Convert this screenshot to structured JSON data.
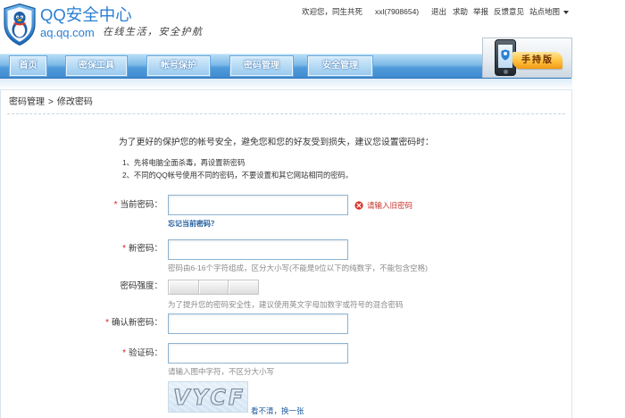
{
  "header": {
    "logo_title": "QQ安全中心",
    "logo_domain": "aq.qq.com",
    "slogan": "在线生活，安全护航",
    "welcome": "欢迎您，同生共死",
    "user": "xxl(7908654)",
    "logout": "退出",
    "help": "求助",
    "report": "举报",
    "feedback": "反馈意见",
    "sitemap": "站点地图",
    "mobile_promo": "手持版"
  },
  "nav": {
    "tabs": [
      "首页",
      "密保工具",
      "帐号保护",
      "密码管理",
      "安全管理"
    ]
  },
  "breadcrumb": {
    "parent": "密码管理",
    "separator": ">",
    "current": "修改密码"
  },
  "intro": {
    "text": "为了更好的保护您的帐号安全，避免您和您的好友受到损失，建议您设置密码时：",
    "tips": [
      "1、先将电脑全面杀毒，再设置新密码",
      "2、不同的QQ帐号使用不同的密码，不要设置和其它网站相同的密码。"
    ]
  },
  "form": {
    "required_mark": "*",
    "current_password": {
      "label": "当前密码：",
      "value": "",
      "error": "请输入旧密码",
      "forgot_link": "忘记当前密码？"
    },
    "new_password": {
      "label": "新密码：",
      "value": "",
      "hint": "密码由6-16个字符组成，区分大小写(不能是9位以下的纯数字，不能包含空格)"
    },
    "strength": {
      "label": "密码强度：",
      "level": 0,
      "hint": "为了提升您的密码安全性，建议使用英文字母加数字或符号的混合密码"
    },
    "confirm_password": {
      "label": "确认新密码：",
      "value": ""
    },
    "captcha": {
      "label": "验证码：",
      "value": "",
      "hint": "请输入图中字符，不区分大小写",
      "image_text": "VYCF",
      "refresh_link": "看不清，换一张"
    }
  },
  "icons": {
    "logo": "qq-security-shield-icon",
    "promo": "mobile-phone-icon",
    "sitemap": "dropdown-arrow-icon",
    "error": "error-icon"
  },
  "colors": {
    "brand_blue": "#2b7fd3",
    "nav_blue": "#4f9bdb",
    "link_blue": "#1e5a9c",
    "error_red": "#c8322a",
    "required_red": "#e0201b",
    "hint_gray": "#8a8a8a"
  }
}
